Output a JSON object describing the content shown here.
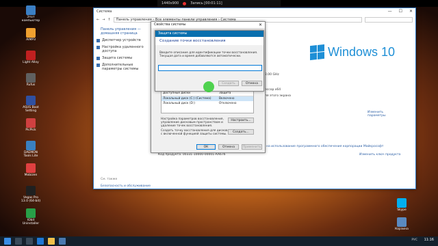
{
  "recorder": {
    "resolution": "1440x900",
    "status": "Запись [00:01:11]"
  },
  "desktop_icons_left": [
    {
      "label": "Этот компьютер",
      "color": "#3b7fc4"
    },
    {
      "label": "AIMP3",
      "color": "#f0a030"
    },
    {
      "label": "Light Alloy",
      "color": "#c02020"
    },
    {
      "label": "Rufus",
      "color": "#606060"
    },
    {
      "label": "ASUS Boot Setting",
      "color": "#3050a0"
    },
    {
      "label": "PicPick",
      "color": "#d04040"
    },
    {
      "label": "DAEMON Tools Lite",
      "color": "#3a80c0"
    },
    {
      "label": "Mobizen",
      "color": "#e04040"
    },
    {
      "label": "Vegas Pro 13.0 (64-bit)",
      "color": "#202020"
    },
    {
      "label": "IObit Uninstaller",
      "color": "#28a048"
    }
  ],
  "desktop_icons_right": [
    {
      "label": "Skype",
      "color": "#00aff0"
    },
    {
      "label": "Корзина",
      "color": "#5a8ac0"
    }
  ],
  "window": {
    "title": "Система",
    "breadcrumb": "Панель управления › Все элементы панели управления › Система",
    "left_header": "Панель управления — домашняя страница",
    "left_links": [
      "Диспетчер устройств",
      "Настройка удаленного доступа",
      "Защита системы",
      "Дополнительные параметры системы"
    ],
    "see_also": "См. также",
    "security_link": "Безопасность и обслуживание",
    "logo_text": "Windows 10",
    "cpu_freq": "2.00 GHz",
    "cpu_arch": "ессор x64",
    "pen": "ля этого экрана",
    "change_params": "Изменить параметры",
    "license_text": "на использование программного обеспечения корпорации Майкрософт",
    "product_code": "Код продукта: 00331-10000-00001-AA676",
    "change_key": "Изменить ключ продукта"
  },
  "dialog": {
    "title": "Свойства системы",
    "drives_header": [
      "Доступные диски",
      "Защита"
    ],
    "drives": [
      {
        "name": "Локальный диск (C:) (Система)",
        "status": "Включено"
      },
      {
        "name": "Локальный диск (D:)",
        "status": "Отключено"
      }
    ],
    "configure_text": "Настройка параметров восстановления, управление дисковым пространством и удаление точек восстановления.",
    "configure_btn": "Настроить...",
    "create_text": "Создать точку восстановления для дисков с включенной функцией защиты системы.",
    "create_btn": "Создать...",
    "ok": "ОК",
    "cancel": "Отмена",
    "apply": "Применить"
  },
  "subdialog": {
    "title": "Защита системы",
    "heading": "Создание точки восстановления",
    "description": "Введите описание для идентификации точки восстановления. Текущая дата и время добавляются автоматически.",
    "input_value": "",
    "create_btn": "Создать",
    "cancel_btn": "Отмена"
  },
  "taskbar": {
    "lang": "РУС",
    "time": "11:16"
  }
}
